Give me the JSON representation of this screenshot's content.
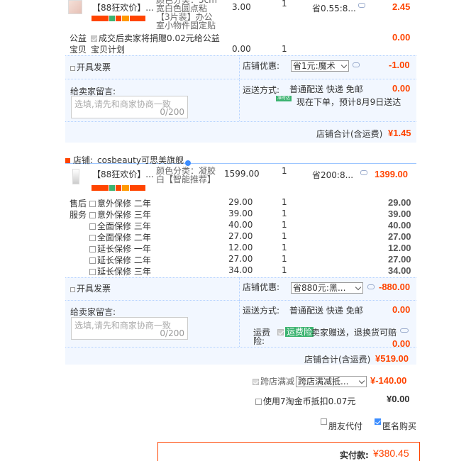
{
  "shop1": {
    "item_title": "【88狂欢价】...",
    "item_spec": "颜色分类：5cm 宽白色圆点粘【3片装】办公 室小物件固定贴",
    "price": "3.00",
    "qty": "1",
    "save": "省0.55:8...",
    "subtotal": "2.45",
    "charity_label": "公益",
    "charity_label2": "宝贝",
    "charity_text": "成交后卖家将捐赠0.02元给公益",
    "charity_text2": "宝贝计划",
    "charity_price": "0.00",
    "charity_qty": "1",
    "charity_subtotal": "0.00",
    "invoice_label": "开具发票",
    "discount_label": "店铺优惠:",
    "discount_select": "省1元:魔术",
    "discount_value": "-1.00",
    "message_label": "给卖家留言:",
    "message_placeholder": "选填,请先和商家协商一致",
    "message_count": "0/200",
    "shipping_label": "运送方式:",
    "shipping_text": "普通配送 快递 免邮",
    "shipping_value": "0.00",
    "delivery_badge": "准时达",
    "delivery_text": "现在下单，预计8月9日送达",
    "total_label": "店铺合计(含运费)",
    "total_value": "¥1.45"
  },
  "shop2": {
    "shop_label": "店铺:",
    "shop_name": "cosbeauty可思美旗舰",
    "item_title": "【88狂欢价】...",
    "item_spec": "颜色分类：凝胶 白【智能推荐】",
    "price": "1599.00",
    "qty": "1",
    "save": "省200:8...",
    "subtotal": "1399.00",
    "service_label": "售后",
    "service_label2": "服务",
    "services": [
      {
        "name": "意外保修 二年",
        "price": "29.00",
        "qty": "1",
        "subtotal": "29.00"
      },
      {
        "name": "意外保修 三年",
        "price": "39.00",
        "qty": "1",
        "subtotal": "39.00"
      },
      {
        "name": "全面保修 三年",
        "price": "40.00",
        "qty": "1",
        "subtotal": "40.00"
      },
      {
        "name": "全面保修 二年",
        "price": "27.00",
        "qty": "1",
        "subtotal": "27.00"
      },
      {
        "name": "延长保修 一年",
        "price": "12.00",
        "qty": "1",
        "subtotal": "12.00"
      },
      {
        "name": "延长保修 二年",
        "price": "27.00",
        "qty": "1",
        "subtotal": "27.00"
      },
      {
        "name": "延长保修 三年",
        "price": "34.00",
        "qty": "1",
        "subtotal": "34.00"
      }
    ],
    "invoice_label": "开具发票",
    "discount_label": "店铺优惠:",
    "discount_select": "省880元:黑...",
    "discount_value": "-880.00",
    "message_label": "给卖家留言:",
    "message_placeholder": "选填,请先和商家协商一致",
    "message_count": "0/200",
    "shipping_label": "运送方式:",
    "shipping_text": "普通配送 快递 免邮",
    "shipping_value": "0.00",
    "insurance_label": "运费",
    "insurance_label2": "险:",
    "insurance_badge": "运费险",
    "insurance_text": "卖家赠送，退换货可赔",
    "insurance_value": "0.00",
    "total_label": "店铺合计(含运费)",
    "total_value": "¥519.00"
  },
  "cross_shop": {
    "label": "跨店满减",
    "select": "跨店满减抵...",
    "value": "¥-140.00"
  },
  "taojinbi": {
    "label": "使用7淘金币抵扣0.07元",
    "value": "¥0.00"
  },
  "options": {
    "friend_pay": "朋友代付",
    "anonymous": "匿名购买"
  },
  "payment": {
    "label": "实付款:",
    "value": "¥380.45"
  },
  "colors": {
    "accent": "#ff4400",
    "band": "#f2f7ff",
    "badge_green": "#3cb371"
  }
}
